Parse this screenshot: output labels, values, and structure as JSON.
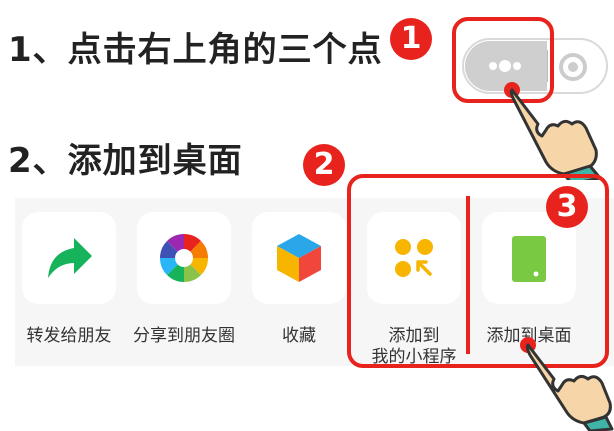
{
  "steps": [
    {
      "number": "1",
      "title": "1、点击右上角的三个点"
    },
    {
      "number": "2",
      "title": "2、添加到桌面"
    },
    {
      "number": "3"
    }
  ],
  "capsule": {
    "more_icon": "three-dots-icon",
    "close_icon": "target-circle-icon"
  },
  "share_items": [
    {
      "label": "转发给朋友",
      "icon": "share-arrow-icon"
    },
    {
      "label": "分享到朋友圈",
      "icon": "camera-aperture-icon"
    },
    {
      "label": "收藏",
      "icon": "cube-icon"
    },
    {
      "label_line1": "添加到",
      "label_line2": "我的小程序",
      "icon": "four-dots-icon"
    },
    {
      "label": "添加到桌面",
      "icon": "phone-icon"
    }
  ],
  "colors": {
    "accent_red": "#e8231e",
    "share_green": "#16b35a",
    "mini_yellow": "#f7b500",
    "desktop_green": "#7ac943",
    "hand_skin": "#f6d6a8",
    "cuff_teal": "#3fb5a8"
  }
}
